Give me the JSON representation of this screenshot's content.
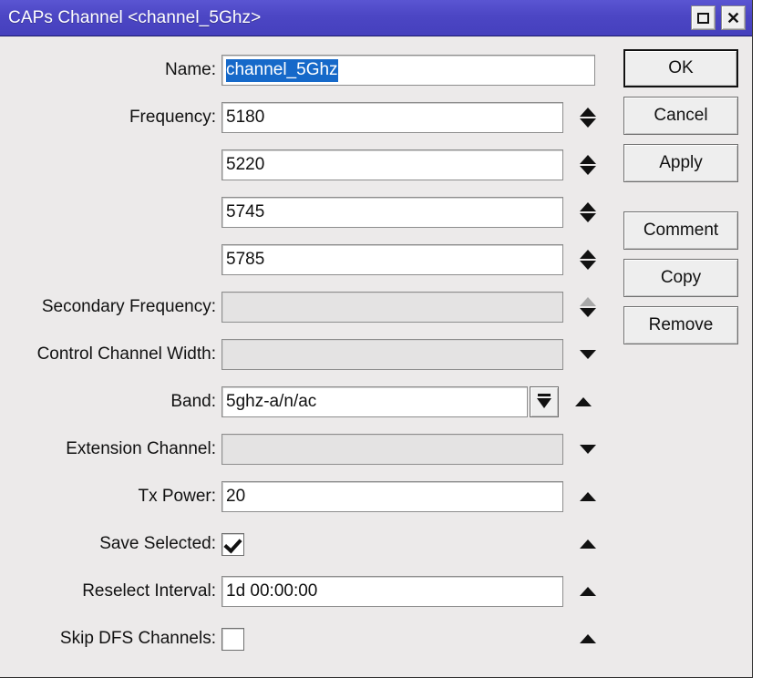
{
  "window": {
    "title": "CAPs Channel <channel_5Ghz>",
    "titlebar_color": "#4c46c4",
    "controls": {
      "restore_label": "restore-window",
      "close_label": "✕"
    }
  },
  "form": {
    "rows": [
      {
        "label": "Name:",
        "value": "channel_5Ghz",
        "kind": "text-selected",
        "disabled": false
      },
      {
        "label": "Frequency:",
        "value": "5180",
        "kind": "spinner",
        "disabled": false
      },
      {
        "label": "",
        "value": "5220",
        "kind": "spinner",
        "disabled": false
      },
      {
        "label": "",
        "value": "5745",
        "kind": "spinner",
        "disabled": false
      },
      {
        "label": "",
        "value": "5785",
        "kind": "spinner",
        "disabled": false
      },
      {
        "label": "Secondary Frequency:",
        "value": "",
        "kind": "spinner-dim",
        "disabled": true
      },
      {
        "label": "Control Channel Width:",
        "value": "",
        "kind": "down-arrow",
        "disabled": true
      },
      {
        "label": "Band:",
        "value": "5ghz-a/n/ac",
        "kind": "dropdown",
        "disabled": false
      },
      {
        "label": "Extension Channel:",
        "value": "",
        "kind": "down-arrow",
        "disabled": true
      },
      {
        "label": "Tx Power:",
        "value": "20",
        "kind": "up-arrow",
        "disabled": false
      },
      {
        "label": "Save Selected:",
        "value": "",
        "kind": "checkbox",
        "checked": true
      },
      {
        "label": "Reselect Interval:",
        "value": "1d 00:00:00",
        "kind": "up-arrow",
        "disabled": false
      },
      {
        "label": "Skip DFS Channels:",
        "value": "",
        "kind": "checkbox",
        "checked": false
      }
    ]
  },
  "buttons": {
    "ok": "OK",
    "cancel": "Cancel",
    "apply": "Apply",
    "comment": "Comment",
    "copy": "Copy",
    "remove": "Remove"
  }
}
